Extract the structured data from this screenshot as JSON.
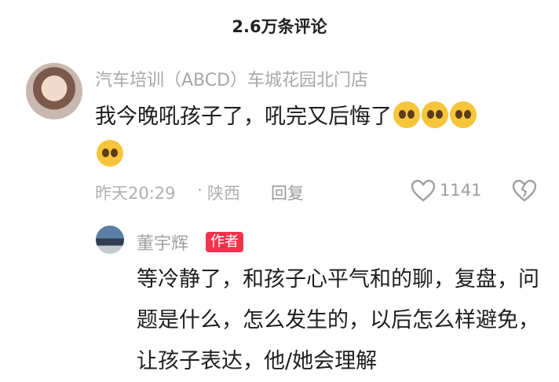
{
  "header": {
    "comment_count_label": "2.6万条评论"
  },
  "comment": {
    "username": "汽车培训（ABCD）车城花园北门店",
    "text": "我今晚吼孩子了，吼完又后悔了",
    "emoji_icon": "pleading-face-emoji",
    "time": "昨天20:29",
    "separator": "·",
    "location": "陕西",
    "reply_label": "回复",
    "like_count": "1141"
  },
  "reply": {
    "username": "董宇辉",
    "badge": "作者",
    "text": "等冷静了，和孩子心平气和的聊，复盘，问题是什么，怎么发生的，以后怎么样避免，让孩子表达，他/她会理解"
  },
  "colors": {
    "badge_bg": "#f2334d",
    "muted_text": "#a7a7a7"
  }
}
